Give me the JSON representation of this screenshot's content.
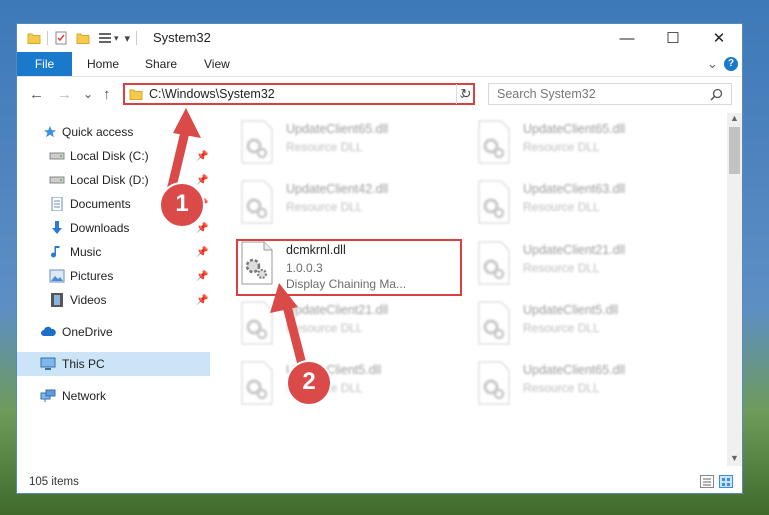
{
  "window": {
    "title": "System32",
    "controls": {
      "minimize": "—",
      "maximize": "☐",
      "close": "✕"
    }
  },
  "ribbon": {
    "tabs": [
      "File",
      "Home",
      "Share",
      "View"
    ],
    "expand_label": "⌄",
    "help_label": "?"
  },
  "navigation": {
    "back": "←",
    "forward": "→",
    "recent": "⌄",
    "up": "↑",
    "address": "C:\\Windows\\System32",
    "search_placeholder": "Search System32"
  },
  "sidebar": {
    "items": [
      {
        "label": "Quick access",
        "icon": "star-icon"
      },
      {
        "label": "Local Disk (C:)",
        "icon": "drive-icon",
        "pinned": true
      },
      {
        "label": "Local Disk (D:)",
        "icon": "drive-icon",
        "pinned": true
      },
      {
        "label": "Documents",
        "icon": "documents-icon",
        "pinned": true
      },
      {
        "label": "Downloads",
        "icon": "download-arrow-icon",
        "pinned": true
      },
      {
        "label": "Music",
        "icon": "music-note-icon",
        "pinned": true
      },
      {
        "label": "Pictures",
        "icon": "pictures-icon",
        "pinned": true
      },
      {
        "label": "Videos",
        "icon": "film-icon",
        "pinned": true
      },
      {
        "label": "OneDrive",
        "icon": "cloud-icon"
      },
      {
        "label": "This PC",
        "icon": "monitor-icon",
        "selected": true
      },
      {
        "label": "Network",
        "icon": "network-icon"
      }
    ]
  },
  "files": [
    {
      "name": "UpdateClient65.dll",
      "lines": [
        "Resource DLL"
      ]
    },
    {
      "name": "UpdateClient65.dll",
      "lines": [
        "Resource DLL"
      ]
    },
    {
      "name": "UpdateClient42.dll",
      "lines": [
        "Resource DLL"
      ]
    },
    {
      "name": "UpdateClient63.dll",
      "lines": [
        "Resource DLL"
      ]
    },
    {
      "name": "dcmkrnl.dll",
      "lines": [
        "1.0.0.3",
        "Display Chaining Ma..."
      ],
      "highlighted": true
    },
    {
      "name": "UpdateClient21.dll",
      "lines": [
        "Resource DLL"
      ]
    },
    {
      "name": "UpdateClient21.dll",
      "lines": [
        "Resource DLL"
      ]
    },
    {
      "name": "UpdateClient5.dll",
      "lines": [
        "Resource DLL"
      ]
    },
    {
      "name": "UpdateClient5.dll",
      "lines": [
        "Resource DLL"
      ]
    },
    {
      "name": "UpdateClient65.dll",
      "lines": [
        "Resource DLL"
      ]
    }
  ],
  "status": {
    "item_count": "105 items"
  },
  "annotations": {
    "step1": "1",
    "step2": "2"
  },
  "colors": {
    "accent": "#1979ca",
    "highlight_red": "#d9403f",
    "callout_red": "#d94a48",
    "selected_bg": "#cce4f7"
  }
}
